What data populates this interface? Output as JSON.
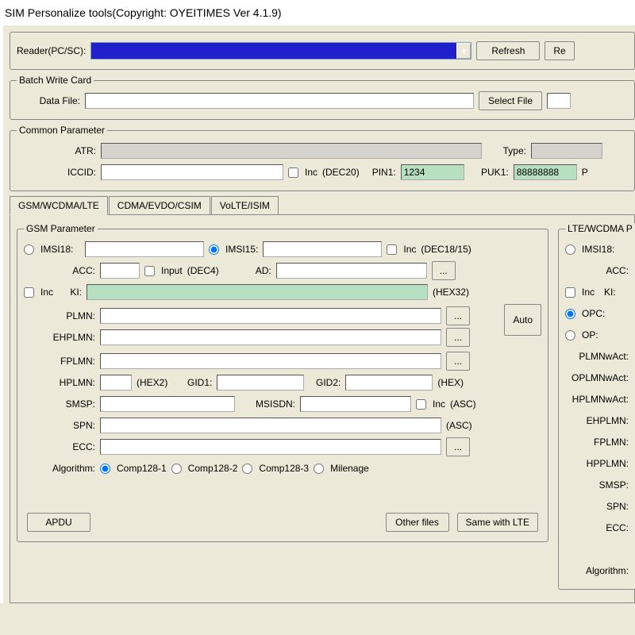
{
  "title": "SIM Personalize tools(Copyright: OYEITIMES Ver 4.1.9)",
  "reader": {
    "label": "Reader(PC/SC):",
    "refresh": "Refresh",
    "re": "Re"
  },
  "batch": {
    "legend": "Batch Write Card",
    "dataFileLabel": "Data File:",
    "selectFile": "Select File"
  },
  "common": {
    "legend": "Common Parameter",
    "atrLabel": "ATR:",
    "typeLabel": "Type:",
    "iccidLabel": "ICCID:",
    "incLabel": "Inc",
    "dec20": "(DEC20)",
    "pin1Label": "PIN1:",
    "pin1Value": "1234",
    "puk1Label": "PUK1:",
    "puk1Value": "88888888",
    "p": "P"
  },
  "tabs": {
    "t1": "GSM/WCDMA/LTE",
    "t2": "CDMA/EVDO/CSIM",
    "t3": "VoLTE/ISIM"
  },
  "gsm": {
    "legend": "GSM Parameter",
    "imsi18": "IMSI18:",
    "imsi15": "IMSI15:",
    "incLabel": "Inc",
    "dec1815": "(DEC18/15)",
    "acc": "ACC:",
    "input": "Input",
    "dec4": "(DEC4)",
    "ad": "AD:",
    "ki": "KI:",
    "hex32": "(HEX32)",
    "plmn": "PLMN:",
    "ehplmn": "EHPLMN:",
    "fplmn": "FPLMN:",
    "hplmn": "HPLMN:",
    "hex2": "(HEX2)",
    "gid1": "GID1:",
    "gid2": "GID2:",
    "hex": "(HEX)",
    "smsp": "SMSP:",
    "msisdn": "MSISDN:",
    "asc": "(ASC)",
    "spn": "SPN:",
    "ecc": "ECC:",
    "algorithm": "Algorithm:",
    "alg1": "Comp128-1",
    "alg2": "Comp128-2",
    "alg3": "Comp128-3",
    "alg4": "Milenage",
    "dots": "...",
    "auto": "Auto",
    "apdu": "APDU",
    "otherFiles": "Other files",
    "sameWithLte": "Same with LTE"
  },
  "lte": {
    "legend": "LTE/WCDMA P",
    "imsi18": "IMSI18:",
    "acc": "ACC:",
    "inc": "Inc",
    "ki": "KI:",
    "opc": "OPC:",
    "op": "OP:",
    "plmnwact": "PLMNwAct:",
    "oplmnwact": "OPLMNwAct:",
    "hplmnwact": "HPLMNwAct:",
    "ehplmn": "EHPLMN:",
    "fplmn": "FPLMN:",
    "hpplmn": "HPPLMN:",
    "smsp": "SMSP:",
    "spn": "SPN:",
    "ecc": "ECC:",
    "algorithm": "Algorithm:"
  }
}
